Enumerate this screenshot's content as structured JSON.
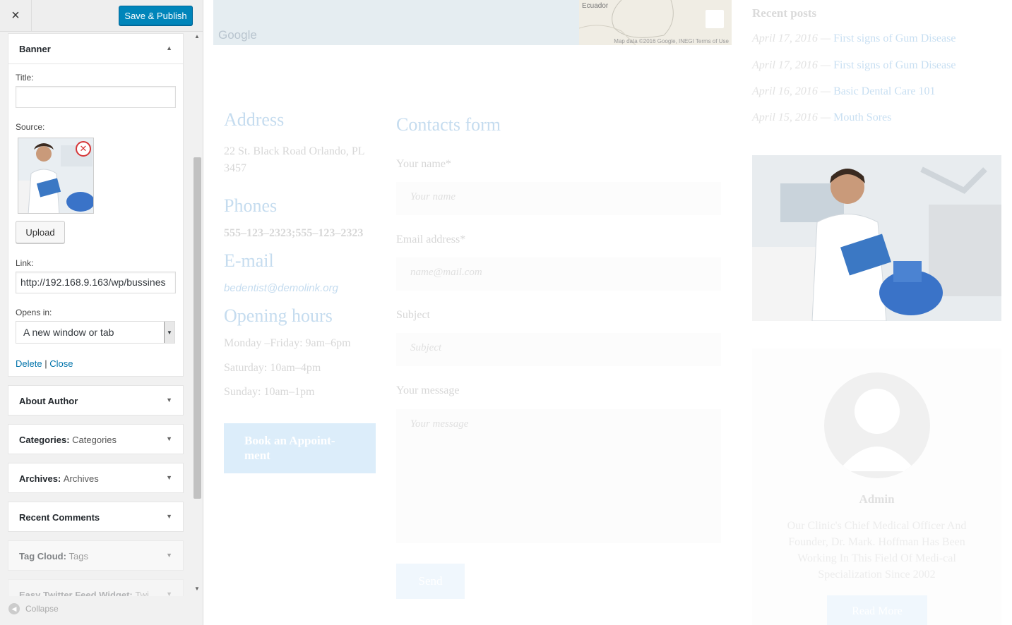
{
  "sidebar": {
    "close_icon": "×",
    "save_label": "Save & Publish",
    "banner": {
      "title": "Banner",
      "title_label": "Title:",
      "title_value": "",
      "source_label": "Source:",
      "upload_label": "Upload",
      "link_label": "Link:",
      "link_value": "http://192.168.9.163/wp/bussines",
      "opens_label": "Opens in:",
      "opens_value": "A new window or tab",
      "delete_label": "Delete",
      "separator": "|",
      "close_label": "Close"
    },
    "widgets": [
      {
        "name": "About Author",
        "sub": ""
      },
      {
        "name": "Categories:",
        "sub": "Categories"
      },
      {
        "name": "Archives:",
        "sub": "Archives"
      },
      {
        "name": "Recent Comments",
        "sub": ""
      },
      {
        "name": "Tag Cloud:",
        "sub": "Tags"
      },
      {
        "name": "Easy Twitter Feed Widget:",
        "sub": "Twi..."
      }
    ],
    "collapse_label": "Collapse"
  },
  "preview": {
    "map": {
      "brand": "Google",
      "place": "Ecuador",
      "attribution": "Map data ©2016 Google, INEGI   Terms of Use"
    },
    "address_title": "Address",
    "address": "22 St. Black Road Orlando, PL 3457",
    "phones_title": "Phones",
    "phones": "555–123–2323;555–123–2323",
    "email_title": "E-mail",
    "email": "bedentist@demolink.org",
    "hours_title": "Opening hours",
    "hours": [
      "Monday –Friday: 9am–6pm",
      "Saturday: 10am–4pm",
      "Sunday: 10am–1pm"
    ],
    "book_label": "Book an Appoint-ment",
    "contacts": {
      "title": "Contacts form",
      "name_label": "Your name*",
      "name_placeholder": "Your name",
      "email_label": "Email address*",
      "email_placeholder": "name@mail.com",
      "subject_label": "Subject",
      "subject_placeholder": "Subject",
      "message_label": "Your message",
      "message_placeholder": "Your message",
      "send_label": "Send"
    },
    "recent_posts": {
      "title": "Recent posts",
      "items": [
        {
          "date": "April 17, 2016",
          "dash": " — ",
          "title": "First signs of Gum Disease"
        },
        {
          "date": "April 17, 2016",
          "dash": " — ",
          "title": "First signs of Gum Disease"
        },
        {
          "date": "April 16, 2016",
          "dash": " — ",
          "title": "Basic Dental Care 101"
        },
        {
          "date": "April 15, 2016",
          "dash": " — ",
          "title": "Mouth Sores"
        }
      ]
    },
    "author": {
      "name": "Admin",
      "bio": "Our Clinic's Chief Medical Officer And Founder, Dr. Mark. Hoffman Has Been Working In This Field Of Medi-cal Specialization Since 2002",
      "read_more": "Read More"
    }
  },
  "colors": {
    "accent": "#0085ba",
    "link": "#0073aa",
    "remove": "#d63638"
  }
}
